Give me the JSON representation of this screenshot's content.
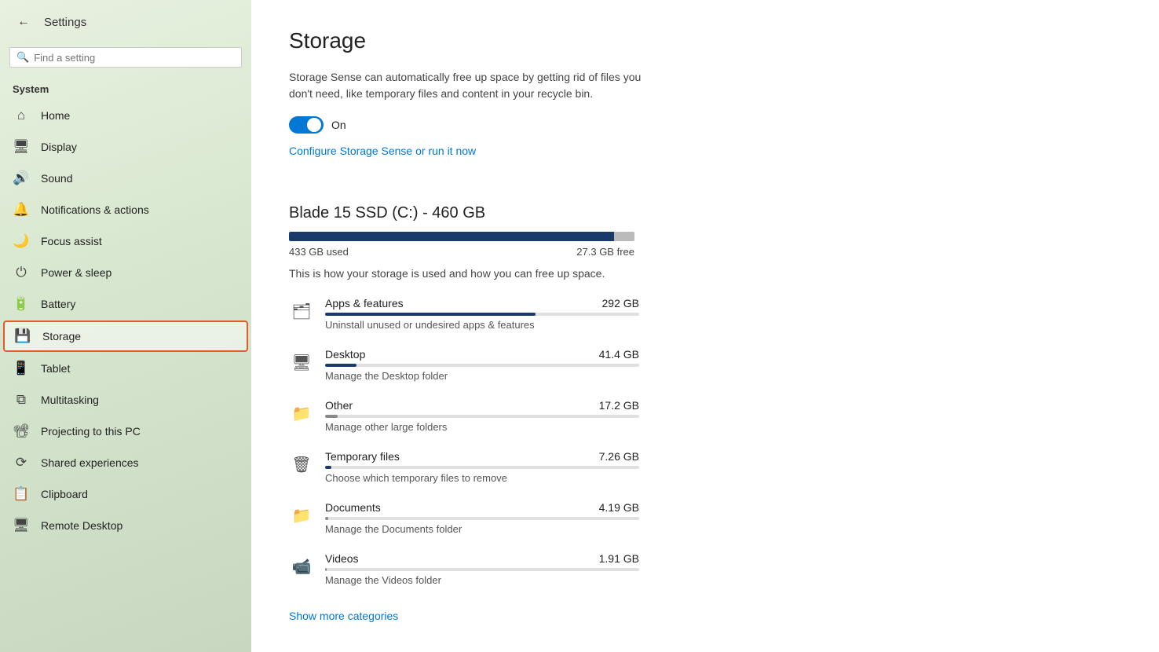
{
  "sidebar": {
    "title": "Settings",
    "search_placeholder": "Find a setting",
    "system_label": "System",
    "nav_items": [
      {
        "id": "home",
        "label": "Home",
        "icon": "⌂",
        "active": false
      },
      {
        "id": "display",
        "label": "Display",
        "icon": "🖥",
        "active": false
      },
      {
        "id": "sound",
        "label": "Sound",
        "icon": "🔊",
        "active": false
      },
      {
        "id": "notifications",
        "label": "Notifications & actions",
        "icon": "🔔",
        "active": false
      },
      {
        "id": "focus",
        "label": "Focus assist",
        "icon": "🌙",
        "active": false
      },
      {
        "id": "power",
        "label": "Power & sleep",
        "icon": "⏻",
        "active": false
      },
      {
        "id": "battery",
        "label": "Battery",
        "icon": "🔋",
        "active": false
      },
      {
        "id": "storage",
        "label": "Storage",
        "icon": "💾",
        "active": true
      },
      {
        "id": "tablet",
        "label": "Tablet",
        "icon": "📱",
        "active": false
      },
      {
        "id": "multitasking",
        "label": "Multitasking",
        "icon": "⧉",
        "active": false
      },
      {
        "id": "projecting",
        "label": "Projecting to this PC",
        "icon": "📽",
        "active": false
      },
      {
        "id": "shared",
        "label": "Shared experiences",
        "icon": "⟳",
        "active": false
      },
      {
        "id": "clipboard",
        "label": "Clipboard",
        "icon": "📋",
        "active": false
      },
      {
        "id": "remote",
        "label": "Remote Desktop",
        "icon": "🖥",
        "active": false
      }
    ]
  },
  "main": {
    "page_title": "Storage",
    "description": "Storage Sense can automatically free up space by getting rid of files you don't need, like temporary files and content in your recycle bin.",
    "toggle_label": "On",
    "config_link": "Configure Storage Sense or run it now",
    "drive_title": "Blade 15 SSD (C:) - 460 GB",
    "used_label": "433 GB used",
    "free_label": "27.3 GB free",
    "used_pct": 94,
    "storage_desc": "This is how your storage is used and how you can free up space.",
    "categories": [
      {
        "id": "apps",
        "icon": "🗂",
        "name": "Apps & features",
        "size": "292 GB",
        "sub": "Uninstall unused or undesired apps & features",
        "fill_pct": 67,
        "fill_color": "#1a3a6b"
      },
      {
        "id": "desktop",
        "icon": "🖥",
        "name": "Desktop",
        "size": "41.4 GB",
        "sub": "Manage the Desktop folder",
        "fill_pct": 10,
        "fill_color": "#1a3a6b"
      },
      {
        "id": "other",
        "icon": "📁",
        "name": "Other",
        "size": "17.2 GB",
        "sub": "Manage other large folders",
        "fill_pct": 4,
        "fill_color": "#888"
      },
      {
        "id": "temp",
        "icon": "🗑",
        "name": "Temporary files",
        "size": "7.26 GB",
        "sub": "Choose which temporary files to remove",
        "fill_pct": 2,
        "fill_color": "#1a3a6b"
      },
      {
        "id": "docs",
        "icon": "📁",
        "name": "Documents",
        "size": "4.19 GB",
        "sub": "Manage the Documents folder",
        "fill_pct": 1,
        "fill_color": "#888"
      },
      {
        "id": "videos",
        "icon": "📹",
        "name": "Videos",
        "size": "1.91 GB",
        "sub": "Manage the Videos folder",
        "fill_pct": 0.5,
        "fill_color": "#888"
      }
    ],
    "show_more_label": "Show more categories"
  }
}
